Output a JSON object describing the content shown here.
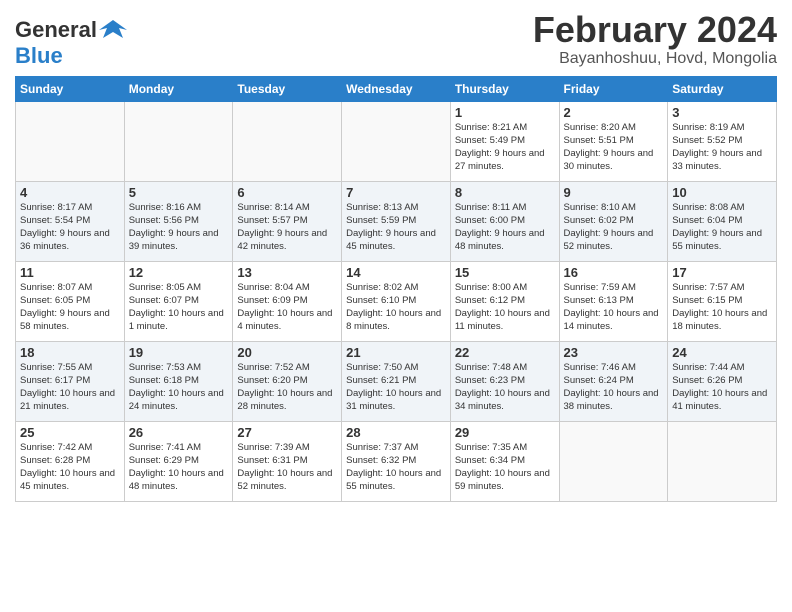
{
  "logo": {
    "line1": "General",
    "line2": "Blue"
  },
  "title": "February 2024",
  "subtitle": "Bayanhoshuu, Hovd, Mongolia",
  "days": [
    "Sunday",
    "Monday",
    "Tuesday",
    "Wednesday",
    "Thursday",
    "Friday",
    "Saturday"
  ],
  "weeks": [
    [
      {
        "day": "",
        "info": ""
      },
      {
        "day": "",
        "info": ""
      },
      {
        "day": "",
        "info": ""
      },
      {
        "day": "",
        "info": ""
      },
      {
        "day": "1",
        "info": "Sunrise: 8:21 AM\nSunset: 5:49 PM\nDaylight: 9 hours and 27 minutes."
      },
      {
        "day": "2",
        "info": "Sunrise: 8:20 AM\nSunset: 5:51 PM\nDaylight: 9 hours and 30 minutes."
      },
      {
        "day": "3",
        "info": "Sunrise: 8:19 AM\nSunset: 5:52 PM\nDaylight: 9 hours and 33 minutes."
      }
    ],
    [
      {
        "day": "4",
        "info": "Sunrise: 8:17 AM\nSunset: 5:54 PM\nDaylight: 9 hours and 36 minutes."
      },
      {
        "day": "5",
        "info": "Sunrise: 8:16 AM\nSunset: 5:56 PM\nDaylight: 9 hours and 39 minutes."
      },
      {
        "day": "6",
        "info": "Sunrise: 8:14 AM\nSunset: 5:57 PM\nDaylight: 9 hours and 42 minutes."
      },
      {
        "day": "7",
        "info": "Sunrise: 8:13 AM\nSunset: 5:59 PM\nDaylight: 9 hours and 45 minutes."
      },
      {
        "day": "8",
        "info": "Sunrise: 8:11 AM\nSunset: 6:00 PM\nDaylight: 9 hours and 48 minutes."
      },
      {
        "day": "9",
        "info": "Sunrise: 8:10 AM\nSunset: 6:02 PM\nDaylight: 9 hours and 52 minutes."
      },
      {
        "day": "10",
        "info": "Sunrise: 8:08 AM\nSunset: 6:04 PM\nDaylight: 9 hours and 55 minutes."
      }
    ],
    [
      {
        "day": "11",
        "info": "Sunrise: 8:07 AM\nSunset: 6:05 PM\nDaylight: 9 hours and 58 minutes."
      },
      {
        "day": "12",
        "info": "Sunrise: 8:05 AM\nSunset: 6:07 PM\nDaylight: 10 hours and 1 minute."
      },
      {
        "day": "13",
        "info": "Sunrise: 8:04 AM\nSunset: 6:09 PM\nDaylight: 10 hours and 4 minutes."
      },
      {
        "day": "14",
        "info": "Sunrise: 8:02 AM\nSunset: 6:10 PM\nDaylight: 10 hours and 8 minutes."
      },
      {
        "day": "15",
        "info": "Sunrise: 8:00 AM\nSunset: 6:12 PM\nDaylight: 10 hours and 11 minutes."
      },
      {
        "day": "16",
        "info": "Sunrise: 7:59 AM\nSunset: 6:13 PM\nDaylight: 10 hours and 14 minutes."
      },
      {
        "day": "17",
        "info": "Sunrise: 7:57 AM\nSunset: 6:15 PM\nDaylight: 10 hours and 18 minutes."
      }
    ],
    [
      {
        "day": "18",
        "info": "Sunrise: 7:55 AM\nSunset: 6:17 PM\nDaylight: 10 hours and 21 minutes."
      },
      {
        "day": "19",
        "info": "Sunrise: 7:53 AM\nSunset: 6:18 PM\nDaylight: 10 hours and 24 minutes."
      },
      {
        "day": "20",
        "info": "Sunrise: 7:52 AM\nSunset: 6:20 PM\nDaylight: 10 hours and 28 minutes."
      },
      {
        "day": "21",
        "info": "Sunrise: 7:50 AM\nSunset: 6:21 PM\nDaylight: 10 hours and 31 minutes."
      },
      {
        "day": "22",
        "info": "Sunrise: 7:48 AM\nSunset: 6:23 PM\nDaylight: 10 hours and 34 minutes."
      },
      {
        "day": "23",
        "info": "Sunrise: 7:46 AM\nSunset: 6:24 PM\nDaylight: 10 hours and 38 minutes."
      },
      {
        "day": "24",
        "info": "Sunrise: 7:44 AM\nSunset: 6:26 PM\nDaylight: 10 hours and 41 minutes."
      }
    ],
    [
      {
        "day": "25",
        "info": "Sunrise: 7:42 AM\nSunset: 6:28 PM\nDaylight: 10 hours and 45 minutes."
      },
      {
        "day": "26",
        "info": "Sunrise: 7:41 AM\nSunset: 6:29 PM\nDaylight: 10 hours and 48 minutes."
      },
      {
        "day": "27",
        "info": "Sunrise: 7:39 AM\nSunset: 6:31 PM\nDaylight: 10 hours and 52 minutes."
      },
      {
        "day": "28",
        "info": "Sunrise: 7:37 AM\nSunset: 6:32 PM\nDaylight: 10 hours and 55 minutes."
      },
      {
        "day": "29",
        "info": "Sunrise: 7:35 AM\nSunset: 6:34 PM\nDaylight: 10 hours and 59 minutes."
      },
      {
        "day": "",
        "info": ""
      },
      {
        "day": "",
        "info": ""
      }
    ]
  ]
}
